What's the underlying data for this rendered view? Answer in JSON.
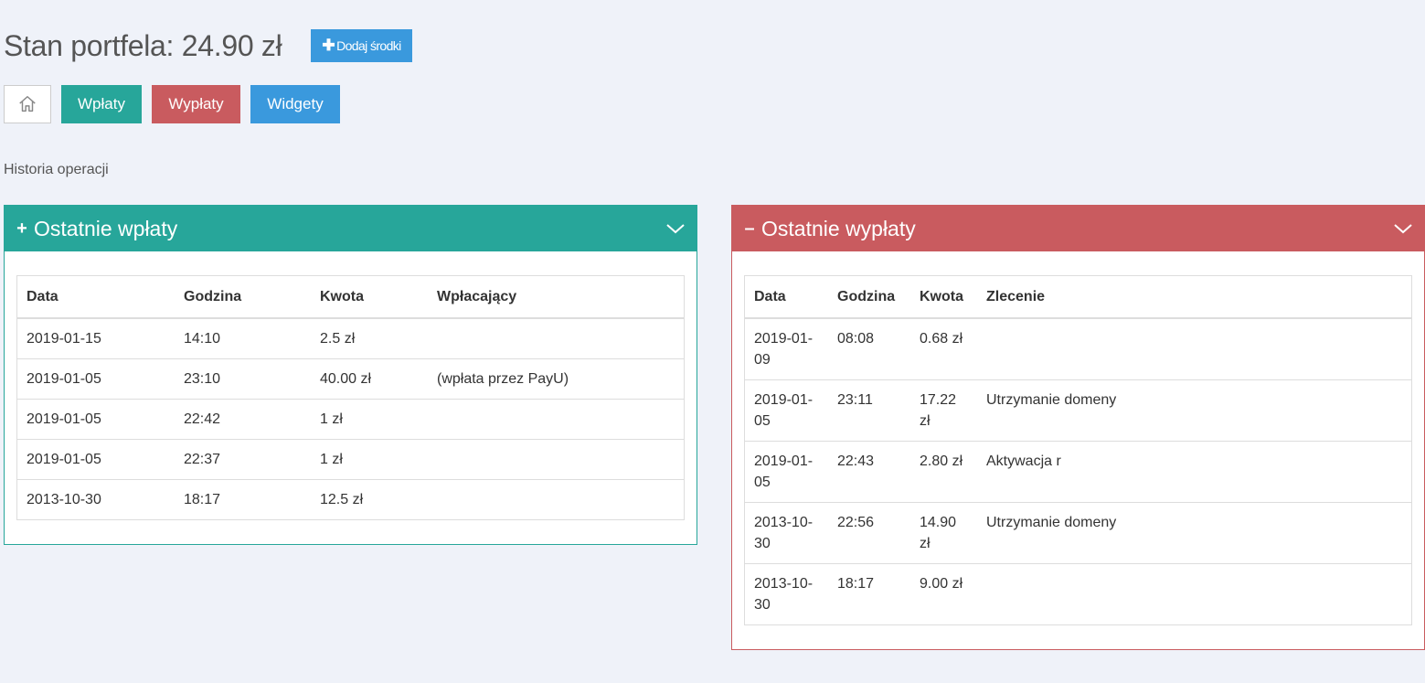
{
  "wallet": {
    "title": "Stan portfela: 24.90 zł",
    "add_funds": "Dodaj środki"
  },
  "nav": {
    "home_icon": "home-icon",
    "deposits": "Wpłaty",
    "withdrawals": "Wypłaty",
    "widgets": "Widgety"
  },
  "history_label": "Historia operacji",
  "colors": {
    "teal": "#27a69a",
    "red": "#c95b5f",
    "blue": "#3a99dd"
  },
  "deposits_panel": {
    "title": "Ostatnie wpłaty",
    "columns": [
      "Data",
      "Godzina",
      "Kwota",
      "Wpłacający"
    ],
    "rows": [
      [
        "2019-01-15",
        "14:10",
        "2.5 zł",
        ""
      ],
      [
        "2019-01-05",
        "23:10",
        "40.00 zł",
        "(wpłata przez PayU)"
      ],
      [
        "2019-01-05",
        "22:42",
        "1 zł",
        ""
      ],
      [
        "2019-01-05",
        "22:37",
        "1 zł",
        ""
      ],
      [
        "2013-10-30",
        "18:17",
        "12.5 zł",
        ""
      ]
    ]
  },
  "withdrawals_panel": {
    "title": "Ostatnie wypłaty",
    "columns": [
      "Data",
      "Godzina",
      "Kwota",
      "Zlecenie"
    ],
    "rows": [
      [
        "2019-01-09",
        "08:08",
        "0.68 zł",
        ""
      ],
      [
        "2019-01-05",
        "23:11",
        "17.22 zł",
        "Utrzymanie domeny"
      ],
      [
        "2019-01-05",
        "22:43",
        "2.80 zł",
        "Aktywacja r"
      ],
      [
        "2013-10-30",
        "22:56",
        "14.90 zł",
        "Utrzymanie domeny"
      ],
      [
        "2013-10-30",
        "18:17",
        "9.00 zł",
        ""
      ]
    ]
  }
}
